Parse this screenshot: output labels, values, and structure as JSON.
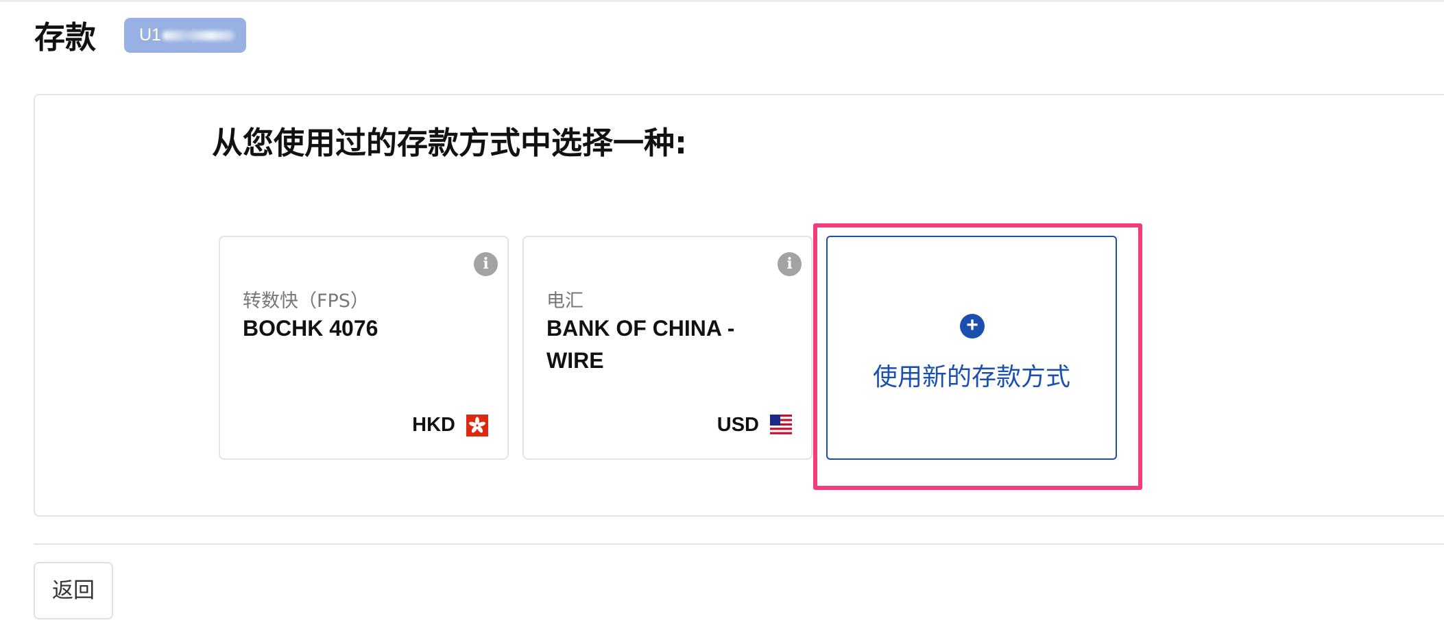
{
  "header": {
    "title": "存款",
    "account_badge": "U1"
  },
  "main": {
    "prompt": "从您使用过的存款方式中选择一种:",
    "methods": [
      {
        "type": "转数快（FPS）",
        "name": "BOCHK 4076",
        "currency": "HKD",
        "flag": "hong-kong-flag"
      },
      {
        "type": "电汇",
        "name": "BANK OF CHINA - WIRE",
        "currency": "USD",
        "flag": "us-flag"
      }
    ],
    "new_method": {
      "label": "使用新的存款方式",
      "icon": "plus-icon"
    }
  },
  "footer": {
    "back_label": "返回"
  },
  "colors": {
    "accent": "#1a4fb0",
    "badge_bg": "#98b0e2",
    "highlight": "#f43d78",
    "hk_flag_red": "#de2910",
    "info_icon": "#a3a3a3"
  }
}
